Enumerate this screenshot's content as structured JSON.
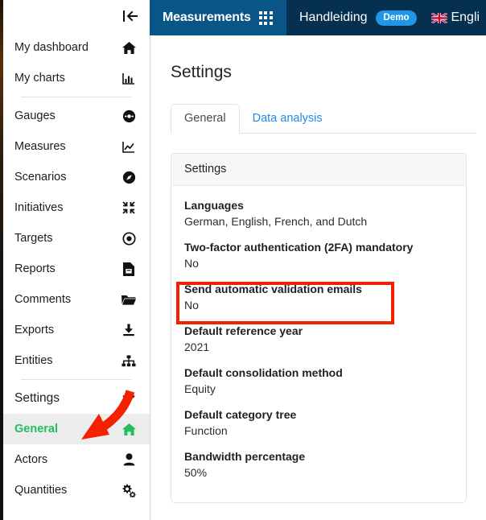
{
  "header": {
    "brand": "Measurements",
    "grid_icon": "apps-grid-icon",
    "manual_link": "Handleiding",
    "demo_badge": "Demo",
    "language": "Engli",
    "flag_icon": "uk-flag-icon",
    "brand_bg": "#095587",
    "nav_bg": "#05304f",
    "badge_bg": "#2196e8"
  },
  "sidebar": {
    "collapse_icon": "collapse-sidebar-icon",
    "active_color": "#21bf5b",
    "items": [
      {
        "label": "My dashboard",
        "icon": "home-icon"
      },
      {
        "label": "My charts",
        "icon": "bar-chart-icon"
      },
      {
        "separator_after": true
      },
      {
        "label": "Gauges",
        "icon": "gauge-icon"
      },
      {
        "label": "Measures",
        "icon": "line-chart-icon"
      },
      {
        "label": "Scenarios",
        "icon": "compass-icon"
      },
      {
        "label": "Initiatives",
        "icon": "collapse-arrows-icon"
      },
      {
        "label": "Targets",
        "icon": "target-icon"
      },
      {
        "label": "Reports",
        "icon": "document-icon"
      },
      {
        "label": "Comments",
        "icon": "folder-icon"
      },
      {
        "label": "Exports",
        "icon": "download-icon"
      },
      {
        "label": "Entities",
        "icon": "org-tree-icon"
      },
      {
        "separator_after": true
      },
      {
        "label": "Settings",
        "icon": "chevron-down-icon",
        "group": true
      },
      {
        "label": "General",
        "icon": "home-icon",
        "active": true
      },
      {
        "label": "Actors",
        "icon": "person-icon"
      },
      {
        "label": "Quantities",
        "icon": "gears-icon"
      }
    ]
  },
  "main": {
    "page_title": "Settings",
    "tabs": [
      {
        "label": "General",
        "active": true
      },
      {
        "label": "Data analysis",
        "active": false
      }
    ],
    "card": {
      "header": "Settings",
      "rows": [
        {
          "key": "Languages",
          "value": "German, English, French, and Dutch"
        },
        {
          "key": "Two-factor authentication (2FA) mandatory",
          "value": "No"
        },
        {
          "key": "Send automatic validation emails",
          "value": "No",
          "highlighted": true
        },
        {
          "key": "Default reference year",
          "value": "2021"
        },
        {
          "key": "Default consolidation method",
          "value": "Equity"
        },
        {
          "key": "Default category tree",
          "value": "Function"
        },
        {
          "key": "Bandwidth percentage",
          "value": "50%"
        }
      ]
    }
  },
  "annotations": {
    "highlight_box_color": "#f52000",
    "arrow_color": "#f52000",
    "highlight_target": "Send automatic validation emails",
    "arrow_target": "General"
  }
}
